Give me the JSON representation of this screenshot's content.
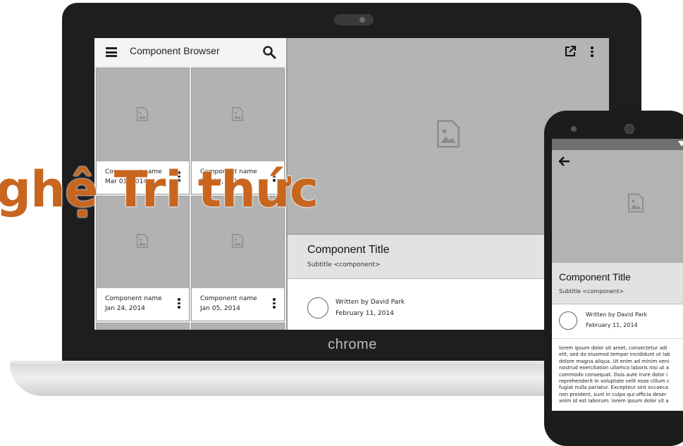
{
  "laptop": {
    "brand": "chrome"
  },
  "left_panel": {
    "title": "Component Browser",
    "cards": [
      {
        "name": "Component name",
        "date": "Mar 01, 2014"
      },
      {
        "name": "Component name",
        "date": "Feb 10, 2014"
      },
      {
        "name": "Component name",
        "date": "Jan 24, 2014"
      },
      {
        "name": "Component name",
        "date": "Jan 05, 2014"
      }
    ]
  },
  "detail": {
    "title": "Component Title",
    "subtitle": "Subtitle <component>",
    "author": "Written by David Park",
    "date": "February 11, 2014"
  },
  "phone": {
    "title": "Component Title",
    "subtitle": "Subtitle <component>",
    "author": "Written by David Park",
    "date": "February 11, 2014",
    "body_lines": [
      "lorem ipsum dolor sit amet, consectetur adi",
      "elit, sed do eiusmod tempor incididunt ut lab",
      "dolore magna aliqua. Ut enim ad minim veni",
      "nostrud exercitation ullamco laboris nisi ut a",
      "commodo consequat. Duis aute irure dolor i",
      "reprehenderit in voluptate velit esse cillum c",
      "fugiat nulla pariatur. Excepteur sint occaeca",
      "non proident, sunt in culpa qui officia deser",
      "anim id est laborum. lorem ipsum dolor sit a"
    ]
  },
  "watermark": {
    "text": "ghệ Tri thức",
    "color": "#c8661f"
  },
  "icons": [
    "menu-icon",
    "search-icon",
    "image-placeholder-icon",
    "more-vert-icon",
    "open-in-new-icon",
    "arrow-back-icon",
    "wifi-icon"
  ]
}
